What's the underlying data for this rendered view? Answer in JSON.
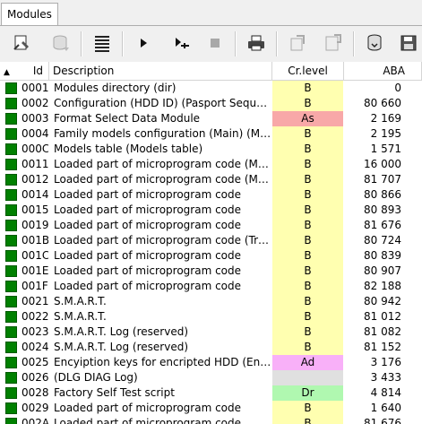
{
  "tab": {
    "label": "Modules"
  },
  "toolbar": {
    "buttons": [
      {
        "name": "module-edit-icon",
        "enabled": true
      },
      {
        "name": "database-read-icon",
        "enabled": false
      },
      {
        "name": "list-view-icon",
        "enabled": true
      },
      {
        "name": "play-icon",
        "enabled": true
      },
      {
        "name": "step-icon",
        "enabled": true
      },
      {
        "name": "stop-icon",
        "enabled": false
      },
      {
        "name": "print-icon",
        "enabled": true
      },
      {
        "name": "copy-module-icon",
        "enabled": false
      },
      {
        "name": "paste-module-icon",
        "enabled": false
      },
      {
        "name": "save-module-icon",
        "enabled": true
      },
      {
        "name": "save-disk-icon",
        "enabled": true
      }
    ]
  },
  "columns": {
    "sort_indicator": "▲",
    "id": "Id",
    "description": "Description",
    "level": "Cr.level",
    "aba": "ABA"
  },
  "level_colors": {
    "B": "#ffffb0",
    "As": "#f8a8a8",
    "Ad": "#f8b0f8",
    "Dr": "#b0f8b0",
    "": "#e0e0e0"
  },
  "rows": [
    {
      "id": "0001",
      "desc": "Modules directory (dir)",
      "level": "B",
      "aba": "0"
    },
    {
      "id": "0002",
      "desc": "Configuration (HDD ID) (Pasport Sequrity B...",
      "level": "B",
      "aba": "80 660"
    },
    {
      "id": "0003",
      "desc": "Format Select Data Module",
      "level": "As",
      "aba": "2 169"
    },
    {
      "id": "0004",
      "desc": "Family models configuration (Main) (Main ...",
      "level": "B",
      "aba": "2 195"
    },
    {
      "id": "000C",
      "desc": "Models table (Models table)",
      "level": "B",
      "aba": "1 571"
    },
    {
      "id": "0011",
      "desc": "Loaded part of microprogram code (Main ...",
      "level": "B",
      "aba": "16 000"
    },
    {
      "id": "0012",
      "desc": "Loaded part of microprogram code (Main ...",
      "level": "B",
      "aba": "81 707"
    },
    {
      "id": "0014",
      "desc": "Loaded part of microprogram code",
      "level": "B",
      "aba": "80 866"
    },
    {
      "id": "0015",
      "desc": "Loaded part of microprogram code",
      "level": "B",
      "aba": "80 893"
    },
    {
      "id": "0019",
      "desc": "Loaded part of microprogram code",
      "level": "B",
      "aba": "81 676"
    },
    {
      "id": "001B",
      "desc": "Loaded part of microprogram code (Transi...",
      "level": "B",
      "aba": "80 724"
    },
    {
      "id": "001C",
      "desc": "Loaded part of microprogram code",
      "level": "B",
      "aba": "80 839"
    },
    {
      "id": "001E",
      "desc": "Loaded part of microprogram code",
      "level": "B",
      "aba": "80 907"
    },
    {
      "id": "001F",
      "desc": "Loaded part of microprogram code",
      "level": "B",
      "aba": "82 188"
    },
    {
      "id": "0021",
      "desc": "S.M.A.R.T.",
      "level": "B",
      "aba": "80 942"
    },
    {
      "id": "0022",
      "desc": "S.M.A.R.T.",
      "level": "B",
      "aba": "81 012"
    },
    {
      "id": "0023",
      "desc": "S.M.A.R.T. Log (reserved)",
      "level": "B",
      "aba": "81 082"
    },
    {
      "id": "0024",
      "desc": "S.M.A.R.T. Log (reserved)",
      "level": "B",
      "aba": "81 152"
    },
    {
      "id": "0025",
      "desc": "Encyiption keys for encripted HDD (Encripti...",
      "level": "Ad",
      "aba": "3 176"
    },
    {
      "id": "0026",
      "desc": " (DLG DIAG Log)",
      "level": "",
      "aba": "3 433"
    },
    {
      "id": "0028",
      "desc": "Factory Self Test script",
      "level": "Dr",
      "aba": "4 814"
    },
    {
      "id": "0029",
      "desc": "Loaded part of microprogram code",
      "level": "B",
      "aba": "1 640"
    },
    {
      "id": "002A",
      "desc": "Loaded part of microprogram code",
      "level": "B",
      "aba": "81 676"
    }
  ]
}
